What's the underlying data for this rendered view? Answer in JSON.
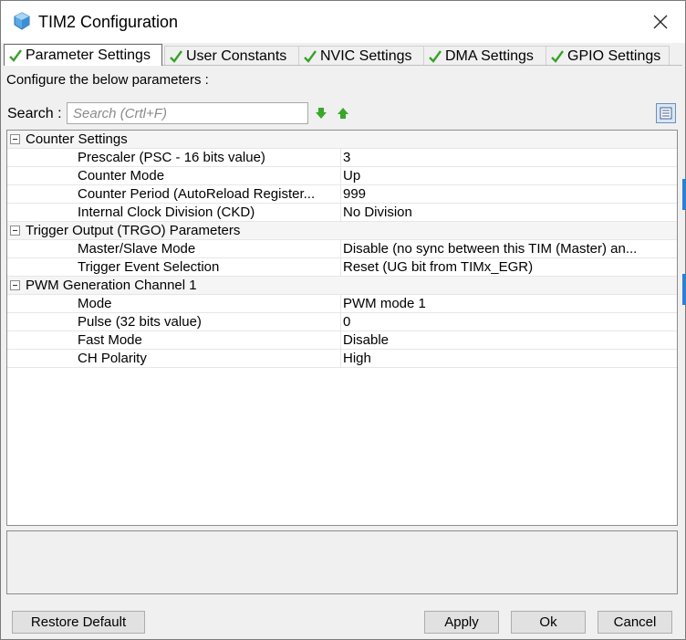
{
  "window": {
    "title": "TIM2 Configuration"
  },
  "tabs": [
    {
      "label": "Parameter Settings",
      "active": true
    },
    {
      "label": "User Constants",
      "active": false
    },
    {
      "label": "NVIC Settings",
      "active": false
    },
    {
      "label": "DMA Settings",
      "active": false
    },
    {
      "label": "GPIO Settings",
      "active": false
    }
  ],
  "description": "Configure the below parameters :",
  "search": {
    "label": "Search :",
    "placeholder": "Search (Crtl+F)"
  },
  "groups": [
    {
      "name": "Counter Settings",
      "params": [
        {
          "name": "Prescaler (PSC - 16 bits value)",
          "value": "3"
        },
        {
          "name": "Counter Mode",
          "value": "Up"
        },
        {
          "name": "Counter Period (AutoReload Register...",
          "value": "999"
        },
        {
          "name": "Internal Clock Division (CKD)",
          "value": "No Division"
        }
      ]
    },
    {
      "name": "Trigger Output (TRGO) Parameters",
      "params": [
        {
          "name": "Master/Slave Mode",
          "value": "Disable (no sync between this TIM (Master) an..."
        },
        {
          "name": "Trigger Event Selection",
          "value": "Reset (UG bit from TIMx_EGR)"
        }
      ]
    },
    {
      "name": "PWM Generation Channel 1",
      "params": [
        {
          "name": "Mode",
          "value": "PWM mode 1"
        },
        {
          "name": "Pulse (32 bits value)",
          "value": "0"
        },
        {
          "name": "Fast Mode",
          "value": "Disable"
        },
        {
          "name": "CH Polarity",
          "value": "High"
        }
      ]
    }
  ],
  "buttons": {
    "restore_default": "Restore Default",
    "apply": "Apply",
    "ok": "Ok",
    "cancel": "Cancel"
  },
  "colors": {
    "check_green": "#3aa12a",
    "arrow_green": "#38a828",
    "highlight_blue": "#2f7fd0"
  }
}
